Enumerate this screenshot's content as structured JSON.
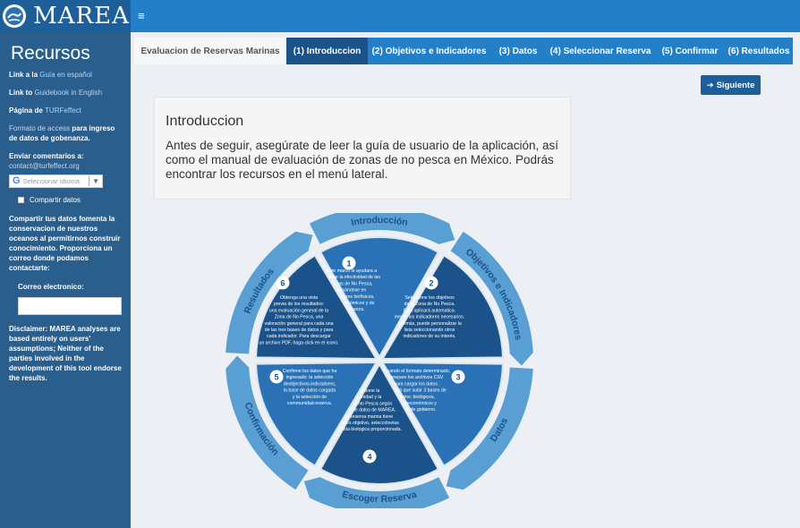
{
  "header": {
    "logo_text": "MAREA",
    "menu_icon": "hamburger-icon"
  },
  "sidebar": {
    "title": "Recursos",
    "link1_prefix": "Link a la",
    "link1_text": "Guía en español",
    "link2_prefix": "Link to",
    "link2_text": "Guidebook in English",
    "link3_prefix": "Página de",
    "link3_text": "TURFeffect",
    "access_text_1": "Formato de access",
    "access_text_2": "para ingreso de datos de gobenanza.",
    "comments_label": "Enviar comentarios a:",
    "comments_email": "contact@turfeffect.org",
    "translate_placeholder": "Seleccionar idioma",
    "share_label": "Compartir datos",
    "share_paragraph": "Compartir tus datos fomenta la conservacion de nuestros oceanos al permitirnos construir conocimiento. Proporciona un correo donde podamos contactarte:",
    "email_label": "Correo electronico:",
    "email_value": "",
    "disclaimer": "Disclaimer: MAREA analyses are based entirely on users' assumptions; Neither of the parties involved in the development of this tool endorse the results."
  },
  "tabs": [
    {
      "label": "Evaluacion de Reservas Marinas"
    },
    {
      "label": "(1) Introduccion"
    },
    {
      "label": "(2) Objetivos e Indicadores"
    },
    {
      "label": "(3) Datos"
    },
    {
      "label": "(4) Seleccionar Reserva"
    },
    {
      "label": "(5) Confirmar"
    },
    {
      "label": "(6) Resultados"
    }
  ],
  "next_button": {
    "label": "Siguiente",
    "icon": "arrow-right-icon"
  },
  "intro": {
    "title": "Introduccion",
    "body": "Antes de seguir, asegúrate de leer la guía de usuario de la aplicación, así como el manual de evaluación de zonas de no pesca en México. Podrás encontrar los recursos en el menú lateral."
  },
  "diagram": {
    "ring_labels": [
      "Introducción",
      "Objetivos e Indicadores",
      "Datos",
      "Escoger Reserva",
      "Confirmación",
      "Resultados"
    ],
    "steps": [
      {
        "num": "1",
        "lines": [
          "Este marco le ayudara a",
          "evaluar la efectividad de las",
          "Zonas de No Pesca,",
          "basándose en",
          "indicadores biofísicos,",
          "socioeconómicos y de",
          "gobernanza."
        ]
      },
      {
        "num": "2",
        "lines": [
          "Seleccione los objetivos",
          "de la Zona de No Pesca.",
          "Esto aplicará automatica-",
          "mente los indicadores necesarios.",
          "Además, puede personalizar la",
          "lista seleccionando otros",
          "indicadores de su interés."
        ]
      },
      {
        "num": "3",
        "lines": [
          "Usando el formato determinado,",
          "prepare los archivos CSV",
          "para cargar  los datos .",
          "Tendrá que subir 3 bases de",
          "datos: biológicos,",
          "socioeconómicos y",
          "datos de gobierno."
        ]
      },
      {
        "num": "4",
        "lines": [
          "Seleccione la",
          "comunidad y la",
          "Zona de No Pesca según",
          "la base de datos de MAREA.",
          "Si su reserva marina tiene",
          "especies objetivo, selecciónelas",
          "de la lista biologica proporcionada."
        ]
      },
      {
        "num": "5",
        "lines": [
          "Confirme los datos que ha",
          "ingresado: la selección",
          "deobjectivos-indicadores,",
          "la base de datos cargada",
          "y la selección de",
          "communidad-reserva."
        ]
      },
      {
        "num": "6",
        "lines": [
          "Obtenga una vista",
          "previa de los resultados:",
          "una evaluación general de la",
          "Zona de No Pesca, una",
          "valoración general para cada una",
          "de las tres bases de datos y para",
          "cada indicador. Para descargar",
          "un archivo PDF, haga click en el icono."
        ]
      }
    ]
  },
  "colors": {
    "header_dark": "#1f5f99",
    "header_bar": "#2380c8",
    "sidebar": "#2a5e8c",
    "tab_active": "#1a5289",
    "ring": "#5a9fd4",
    "wedge_dark": "#1a5289",
    "wedge_mid": "#2a72b5"
  }
}
